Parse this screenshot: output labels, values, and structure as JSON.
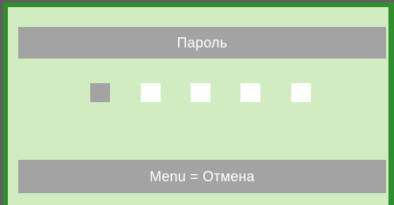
{
  "dialog": {
    "title": "Пароль",
    "footer": "Menu = Отмена",
    "pin_slots": [
      {
        "state": "active"
      },
      {
        "state": "empty"
      },
      {
        "state": "empty"
      },
      {
        "state": "empty"
      },
      {
        "state": "empty"
      }
    ]
  },
  "colors": {
    "panel_background": "#d2ecc2",
    "bar_background": "#a3a3a3",
    "border_green": "#2f8f2f",
    "slot_active": "#a3a3a3",
    "slot_empty": "#ffffff"
  }
}
